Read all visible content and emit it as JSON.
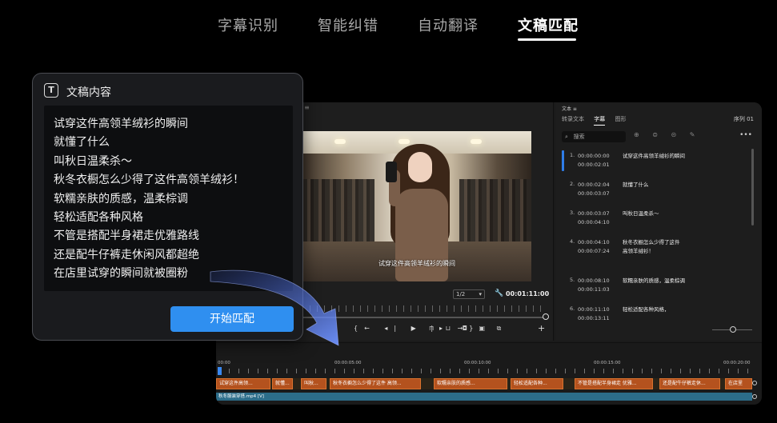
{
  "top_tabs": {
    "items": [
      {
        "label": "字幕识别"
      },
      {
        "label": "智能纠错"
      },
      {
        "label": "自动翻译"
      },
      {
        "label": "文稿匹配"
      }
    ],
    "active_index": 3
  },
  "script_card": {
    "icon": "text-box-icon",
    "icon_glyph": "T",
    "title": "文稿内容",
    "lines": [
      "试穿这件高领羊绒衫的瞬间",
      "就懂了什么",
      "叫秋日温柔杀～",
      "秋冬衣橱怎么少得了这件高领羊绒衫！",
      "软糯亲肤的质感，温柔棕调",
      "轻松适配各种风格",
      "不管是搭配半身裙走优雅路线",
      "还是配牛仔裤走休闲风都超绝",
      "在店里试穿的瞬间就被圈粉"
    ],
    "start_button": "开始匹配",
    "button_color": "#2f8ff0"
  },
  "monitor": {
    "caption": "试穿这件高领羊绒衫的瞬间",
    "scale": "1/2",
    "timecode": "00:01:11:00"
  },
  "text_panel": {
    "title": "文本 ≡",
    "tabs": [
      "转录文本",
      "字幕",
      "图形"
    ],
    "active_tab": 1,
    "sequence": "序列 01",
    "search_placeholder": "搜索",
    "subtitles": [
      {
        "num": "1.",
        "start": "00:00:00:00",
        "end": "00:00:02:01",
        "text": "试穿这件高领羊绒衫的瞬间"
      },
      {
        "num": "2.",
        "start": "00:00:02:04",
        "end": "00:00:03:07",
        "text": "就懂了什么"
      },
      {
        "num": "3.",
        "start": "00:00:03:07",
        "end": "00:00:04:10",
        "text": "叫秋日温柔杀～"
      },
      {
        "num": "4.",
        "start": "00:00:04:10",
        "end": "00:00:07:24",
        "text": "秋冬衣橱怎么少得了这件高领羊绒衫！"
      },
      {
        "num": "5.",
        "start": "00:00:08:10",
        "end": "00:00:11:03",
        "text": "软糯亲肤的质感，温柔棕调"
      },
      {
        "num": "6.",
        "start": "00:00:11:10",
        "end": "00:00:13:11",
        "text": "轻松适配各种风格，"
      }
    ]
  },
  "timeline": {
    "times": [
      "00:00",
      "00:00:05:00",
      "00:00:10:00",
      "00:00:15:00",
      "00:00:20:00"
    ],
    "clips": [
      "试穿这件高领...",
      "就懂...",
      "叫秋...",
      "秋冬衣橱怎么少得了这件 高领...",
      "软糯亲肤的质感...",
      "轻松适配各种...",
      "不管是搭配半身裙走 优雅...",
      "还是配牛仔裤走休...",
      "在店里"
    ],
    "video_clip": "秋冬服装穿搭.mp4 [V]",
    "clip_color": "#b4521e",
    "video_color": "#2c6d8a"
  }
}
